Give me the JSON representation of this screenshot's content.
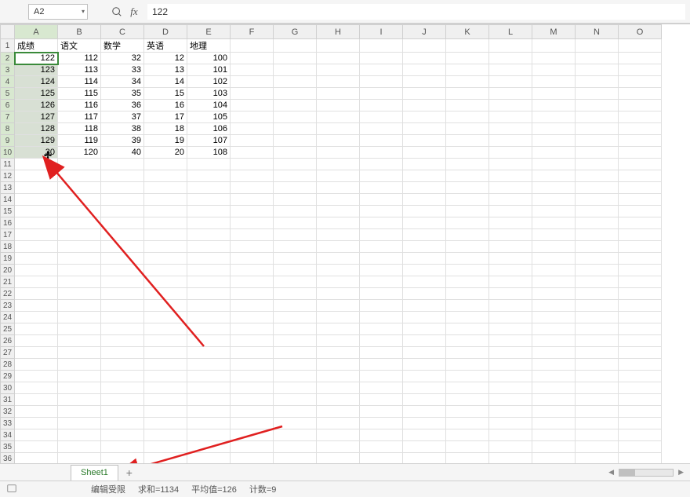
{
  "name_box": {
    "value": "A2"
  },
  "formula_bar": {
    "value": "122"
  },
  "columns": [
    "A",
    "B",
    "C",
    "D",
    "E",
    "F",
    "G",
    "H",
    "I",
    "J",
    "K",
    "L",
    "M",
    "N",
    "O"
  ],
  "row_count": 36,
  "selected_col_index": 0,
  "selected_rows": [
    2,
    3,
    4,
    5,
    6,
    7,
    8,
    9,
    10
  ],
  "active_cell": {
    "row": 2,
    "col": 0
  },
  "header_row": [
    "成绩",
    "语文",
    "数学",
    "英语",
    "地理"
  ],
  "data_rows": [
    [
      122,
      112,
      32,
      12,
      100
    ],
    [
      123,
      113,
      33,
      13,
      101
    ],
    [
      124,
      114,
      34,
      14,
      102
    ],
    [
      125,
      115,
      35,
      15,
      103
    ],
    [
      126,
      116,
      36,
      16,
      104
    ],
    [
      127,
      117,
      37,
      17,
      105
    ],
    [
      128,
      118,
      38,
      18,
      106
    ],
    [
      129,
      119,
      39,
      19,
      107
    ],
    [
      130,
      120,
      40,
      20,
      108
    ]
  ],
  "cursor_cell_display": "30",
  "sheet_tab": {
    "name": "Sheet1"
  },
  "status": {
    "edit_limit": "编辑受限",
    "sum": "求和=1134",
    "avg": "平均值=126",
    "count": "计数=9"
  },
  "chart_data": {
    "type": "table",
    "title": "",
    "columns": [
      "成绩",
      "语文",
      "数学",
      "英语",
      "地理"
    ],
    "rows": [
      [
        122,
        112,
        32,
        12,
        100
      ],
      [
        123,
        113,
        33,
        13,
        101
      ],
      [
        124,
        114,
        34,
        14,
        102
      ],
      [
        125,
        115,
        35,
        15,
        103
      ],
      [
        126,
        116,
        36,
        16,
        104
      ],
      [
        127,
        117,
        37,
        17,
        105
      ],
      [
        128,
        118,
        38,
        18,
        106
      ],
      [
        129,
        119,
        39,
        19,
        107
      ],
      [
        130,
        120,
        40,
        20,
        108
      ]
    ]
  }
}
